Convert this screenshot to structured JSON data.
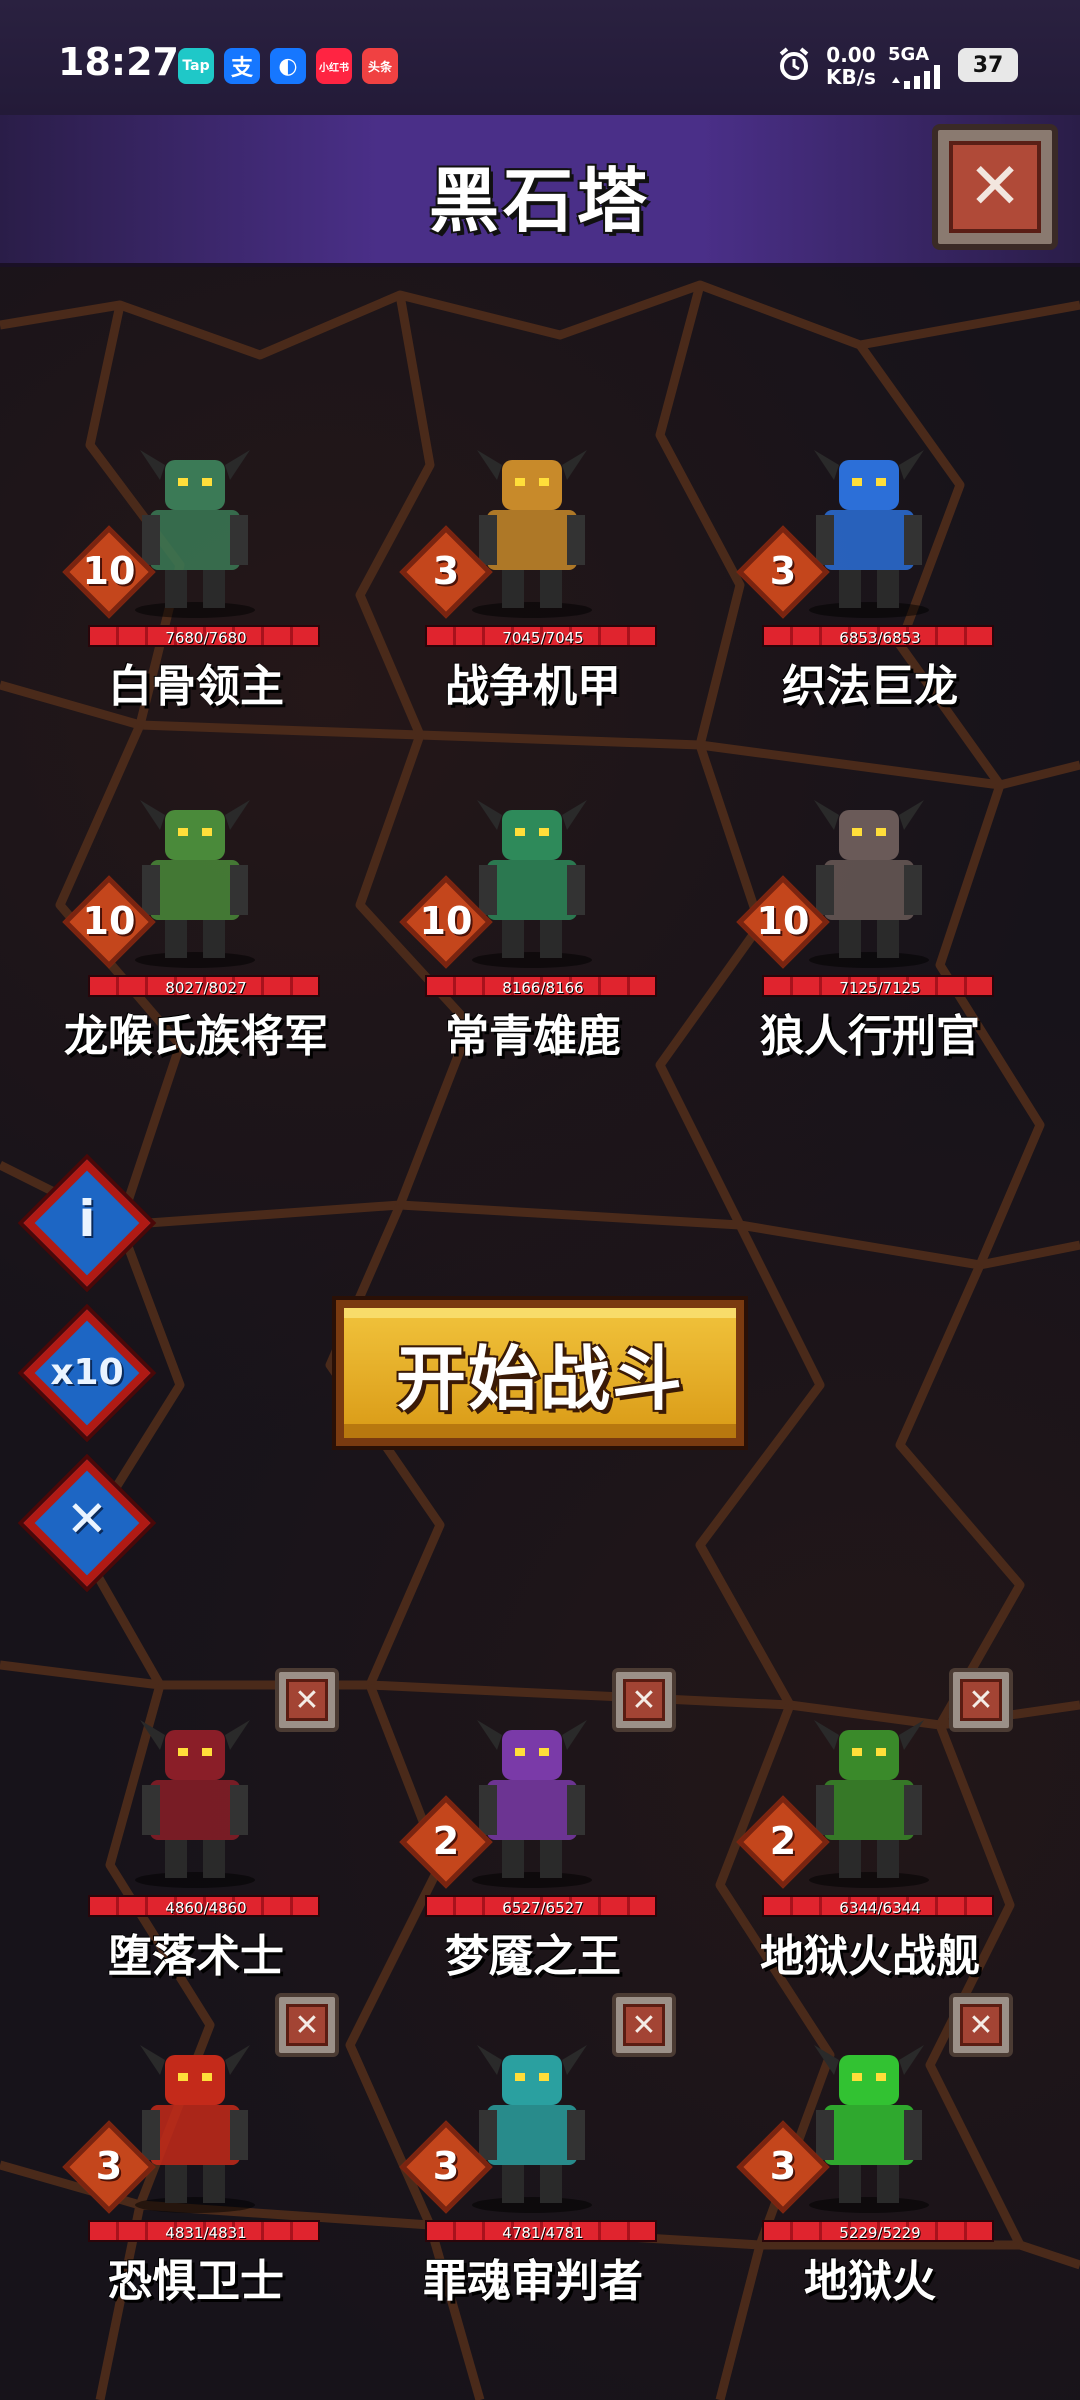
{
  "status_bar": {
    "time": "18:27",
    "apps": [
      {
        "label": "Tap",
        "color": "#1fc8c8",
        "icon": "taptap-icon"
      },
      {
        "label": "支",
        "color": "#1677ff",
        "icon": "alipay-icon"
      },
      {
        "label": "◐",
        "color": "#1677ff",
        "icon": "browser-icon"
      },
      {
        "label": "小红书",
        "color": "#ff2442",
        "icon": "xiaohongshu-icon"
      },
      {
        "label": "头条",
        "color": "#f04142",
        "icon": "toutiao-icon"
      }
    ],
    "net_speed_value": "0.00",
    "net_speed_unit": "KB/s",
    "network": "5GA",
    "battery": "37"
  },
  "header": {
    "title": "黑石塔",
    "close_icon": "close-icon"
  },
  "enemies": [
    {
      "name": "白骨领主",
      "level": "10",
      "hp": "7680/7680",
      "hp_fraction": 1,
      "color": "#3b7a56"
    },
    {
      "name": "战争机甲",
      "level": "3",
      "hp": "7045/7045",
      "hp_fraction": 1,
      "color": "#c88a2a"
    },
    {
      "name": "织法巨龙",
      "level": "3",
      "hp": "6853/6853",
      "hp_fraction": 1,
      "color": "#2c6fd8"
    },
    {
      "name": "龙喉氏族将军",
      "level": "10",
      "hp": "8027/8027",
      "hp_fraction": 1,
      "color": "#4a8a3a"
    },
    {
      "name": "常青雄鹿",
      "level": "10",
      "hp": "8166/8166",
      "hp_fraction": 1,
      "color": "#2e8a5a"
    },
    {
      "name": "狼人行刑官",
      "level": "10",
      "hp": "7125/7125",
      "hp_fraction": 1,
      "color": "#6a5a58"
    }
  ],
  "side_buttons": [
    {
      "label": "i",
      "icon": "info-icon"
    },
    {
      "label": "x10",
      "icon": "x10-speed-icon"
    },
    {
      "label": "✕",
      "icon": "cancel-icon"
    }
  ],
  "start_button": {
    "label": "开始战斗"
  },
  "allies": [
    {
      "name": "堕落术士",
      "level": "",
      "hp": "4860/4860",
      "hp_fraction": 1,
      "color": "#8a1e28"
    },
    {
      "name": "梦魇之王",
      "level": "2",
      "hp": "6527/6527",
      "hp_fraction": 1,
      "color": "#7a3aa8"
    },
    {
      "name": "地狱火战舰",
      "level": "2",
      "hp": "6344/6344",
      "hp_fraction": 1,
      "color": "#3a8a2a"
    },
    {
      "name": "恐惧卫士",
      "level": "3",
      "hp": "4831/4831",
      "hp_fraction": 1,
      "color": "#c42a1a"
    },
    {
      "name": "罪魂审判者",
      "level": "3",
      "hp": "4781/4781",
      "hp_fraction": 1,
      "color": "#2aa0a0"
    },
    {
      "name": "地狱火",
      "level": "3",
      "hp": "5229/5229",
      "hp_fraction": 1,
      "color": "#32c232"
    }
  ]
}
